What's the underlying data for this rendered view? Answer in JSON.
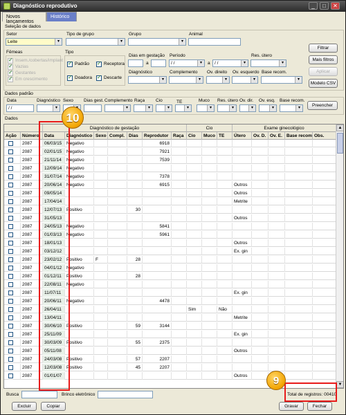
{
  "window": {
    "title": "Diagnóstico reprodutivo",
    "minimize": "_",
    "maximize": "□",
    "close": "✕"
  },
  "tabs": [
    {
      "label": "Novos lançamentos"
    },
    {
      "label": "Histórico"
    }
  ],
  "selecao": {
    "title": "Seleção de dados",
    "setor_label": "Setor",
    "setor_value": "Leite",
    "tipo_grupo_label": "Tipo de grupo",
    "tipo_grupo_value": "",
    "grupo_label": "Grupo",
    "grupo_value": "",
    "animal_label": "Animal",
    "animal_value": "",
    "femeas_label": "Fêmeas",
    "femeas": [
      {
        "label": "Insem./cobertas/implant"
      },
      {
        "label": "Vazias"
      },
      {
        "label": "Gestantes"
      },
      {
        "label": "Em crescimento"
      }
    ],
    "tipo_label": "Tipo",
    "tipo": [
      {
        "label": "Padrão"
      },
      {
        "label": "Receptora"
      },
      {
        "label": "Doadora"
      },
      {
        "label": "Descarte"
      }
    ],
    "dias_gestacao_label": "Dias em gestação",
    "dias_a": "a",
    "periodo_label": "Período",
    "periodo_from": "/ /",
    "periodo_a": "a",
    "periodo_to": "/ /",
    "res_utero_label": "Res. útero",
    "diagnostico_label": "Diagnóstico",
    "complemento_label": "Complemento",
    "ov_direito_label": "Ov. direito",
    "ov_esquerdo_label": "Ov. esquerdo",
    "base_recom_label": "Base recom.",
    "buttons": {
      "filtrar": "Filtrar",
      "mais_filtros": "Mais filtros",
      "aplicar": "Aplicar",
      "modelo_csv": "Modelo CSV"
    }
  },
  "padrao": {
    "title": "Dados padrão",
    "labels": [
      "Data",
      "Diagnóstico",
      "Sexo",
      "Dias gest.",
      "Complemento",
      "Raça",
      "Cio",
      "TE",
      "Muco",
      "Res. útero",
      "Ov. dir.",
      "Ov. esq.",
      "Base recom."
    ],
    "data_value": "/ /",
    "preencher": "Preencher"
  },
  "dados": {
    "title": "Dados",
    "group_headers": {
      "diag": "Diagnóstico de gestação",
      "cio": "Cio",
      "exame": "Exame ginecológico"
    },
    "columns": [
      "Ação",
      "Número",
      "Data",
      "Diagnóstico",
      "Sexo",
      "Compl.",
      "Dias",
      "Reprodutor",
      "Raça",
      "Cio",
      "Muco",
      "TE",
      "Útero",
      "Ov. D.",
      "Ov. E.",
      "Base recom",
      "Obs."
    ],
    "rows": [
      [
        "2087",
        "06/03/15",
        "Negativo",
        "",
        "",
        "",
        "6918",
        "",
        "",
        "",
        "",
        "",
        "",
        "",
        "",
        ""
      ],
      [
        "2087",
        "02/01/15",
        "Negativo",
        "",
        "",
        "",
        "7921",
        "",
        "",
        "",
        "",
        "",
        "",
        "",
        "",
        ""
      ],
      [
        "2087",
        "21/11/14",
        "Negativo",
        "",
        "",
        "",
        "7539",
        "",
        "",
        "",
        "",
        "",
        "",
        "",
        "",
        ""
      ],
      [
        "2087",
        "12/09/14",
        "Negativo",
        "",
        "",
        "",
        "",
        "",
        "",
        "",
        "",
        "",
        "",
        "",
        "",
        ""
      ],
      [
        "2087",
        "31/07/14",
        "Negativo",
        "",
        "",
        "",
        "7378",
        "",
        "",
        "",
        "",
        "",
        "",
        "",
        "",
        ""
      ],
      [
        "2087",
        "20/06/14",
        "Negativo",
        "",
        "",
        "",
        "6915",
        "",
        "",
        "",
        "",
        "Outros",
        "",
        "",
        "",
        ""
      ],
      [
        "2087",
        "09/05/14",
        "",
        "",
        "",
        "",
        "",
        "",
        "",
        "",
        "",
        "Outros",
        "",
        "",
        "",
        ""
      ],
      [
        "2087",
        "17/04/14",
        "",
        "",
        "",
        "",
        "",
        "",
        "",
        "",
        "",
        "Metrite",
        "",
        "",
        "",
        ""
      ],
      [
        "2087",
        "12/07/13",
        "Positivo",
        "",
        "",
        "30",
        "",
        "",
        "",
        "",
        "",
        "",
        "",
        "",
        "",
        ""
      ],
      [
        "2087",
        "31/05/13",
        "",
        "",
        "",
        "",
        "",
        "",
        "",
        "",
        "",
        "Outros",
        "",
        "",
        "",
        ""
      ],
      [
        "2087",
        "24/05/13",
        "Negativo",
        "",
        "",
        "",
        "5841",
        "",
        "",
        "",
        "",
        "",
        "",
        "",
        "",
        ""
      ],
      [
        "2087",
        "01/03/13",
        "Negativo",
        "",
        "",
        "",
        "5961",
        "",
        "",
        "",
        "",
        "",
        "",
        "",
        "",
        ""
      ],
      [
        "2087",
        "18/01/13",
        "",
        "",
        "",
        "",
        "",
        "",
        "",
        "",
        "",
        "Outros",
        "",
        "",
        "",
        ""
      ],
      [
        "2087",
        "03/12/12",
        "",
        "",
        "",
        "",
        "",
        "",
        "",
        "",
        "",
        "Ex. gin",
        "",
        "",
        "",
        ""
      ],
      [
        "2087",
        "23/02/12",
        "Positivo",
        "F",
        "",
        "28",
        "",
        "",
        "",
        "",
        "",
        "",
        "",
        "",
        "",
        ""
      ],
      [
        "2087",
        "04/01/12",
        "Negativo",
        "",
        "",
        "",
        "",
        "",
        "",
        "",
        "",
        "",
        "",
        "",
        "",
        ""
      ],
      [
        "2087",
        "01/12/11",
        "Positivo",
        "",
        "",
        "28",
        "",
        "",
        "",
        "",
        "",
        "",
        "",
        "",
        "",
        ""
      ],
      [
        "2087",
        "22/08/11",
        "Negativo",
        "",
        "",
        "",
        "",
        "",
        "",
        "",
        "",
        "",
        "",
        "",
        "",
        ""
      ],
      [
        "2087",
        "11/07/11",
        "",
        "",
        "",
        "",
        "",
        "",
        "",
        "",
        "",
        "Ex. gin",
        "",
        "",
        "",
        ""
      ],
      [
        "2087",
        "20/06/11",
        "Negativo",
        "",
        "",
        "",
        "4478",
        "",
        "",
        "",
        "",
        "",
        "",
        "",
        "",
        ""
      ],
      [
        "2087",
        "26/04/11",
        "",
        "",
        "",
        "",
        "",
        "",
        "Sim",
        "",
        "Não",
        "",
        "",
        "",
        "",
        ""
      ],
      [
        "2087",
        "13/04/11",
        "",
        "",
        "",
        "",
        "",
        "",
        "",
        "",
        "",
        "Metrite",
        "",
        "",
        "",
        ""
      ],
      [
        "2087",
        "30/06/10",
        "Positivo",
        "",
        "",
        "59",
        "3144",
        "",
        "",
        "",
        "",
        "",
        "",
        "",
        "",
        ""
      ],
      [
        "2087",
        "25/11/09",
        "",
        "",
        "",
        "",
        "",
        "",
        "",
        "",
        "",
        "Ex. gin",
        "",
        "",
        "",
        ""
      ],
      [
        "2087",
        "30/03/09",
        "Positivo",
        "",
        "",
        "55",
        "2375",
        "",
        "",
        "",
        "",
        "",
        "",
        "",
        "",
        ""
      ],
      [
        "2087",
        "05/11/08",
        "",
        "",
        "",
        "",
        "",
        "",
        "",
        "",
        "",
        "Outros",
        "",
        "",
        "",
        ""
      ],
      [
        "2087",
        "24/03/08",
        "Positivo",
        "",
        "",
        "57",
        "2207",
        "",
        "",
        "",
        "",
        "",
        "",
        "",
        "",
        ""
      ],
      [
        "2087",
        "12/03/08",
        "Positivo",
        "",
        "",
        "45",
        "2207",
        "",
        "",
        "",
        "",
        "",
        "",
        "",
        "",
        ""
      ],
      [
        "2087",
        "01/01/07",
        "",
        "",
        "",
        "",
        "",
        "",
        "",
        "",
        "",
        "Outros",
        "",
        "",
        "",
        ""
      ]
    ]
  },
  "footer": {
    "busca_label": "Busca",
    "busca_value": "",
    "brinco_label": "Brinco eletrônico",
    "brinco_value": "",
    "total_label": "Total de registros: 00410",
    "excluir": "Excluir",
    "copiar": "Copiar",
    "gravar": "Gravar",
    "fechar": "Fechar"
  },
  "annotations": {
    "badge_10": "10",
    "badge_9": "9"
  },
  "colors": {
    "highlight": "#e81a1a",
    "badge": "#f2a400",
    "tab_active": "#6a7fc8",
    "setor_bg": "#fffbc8"
  }
}
